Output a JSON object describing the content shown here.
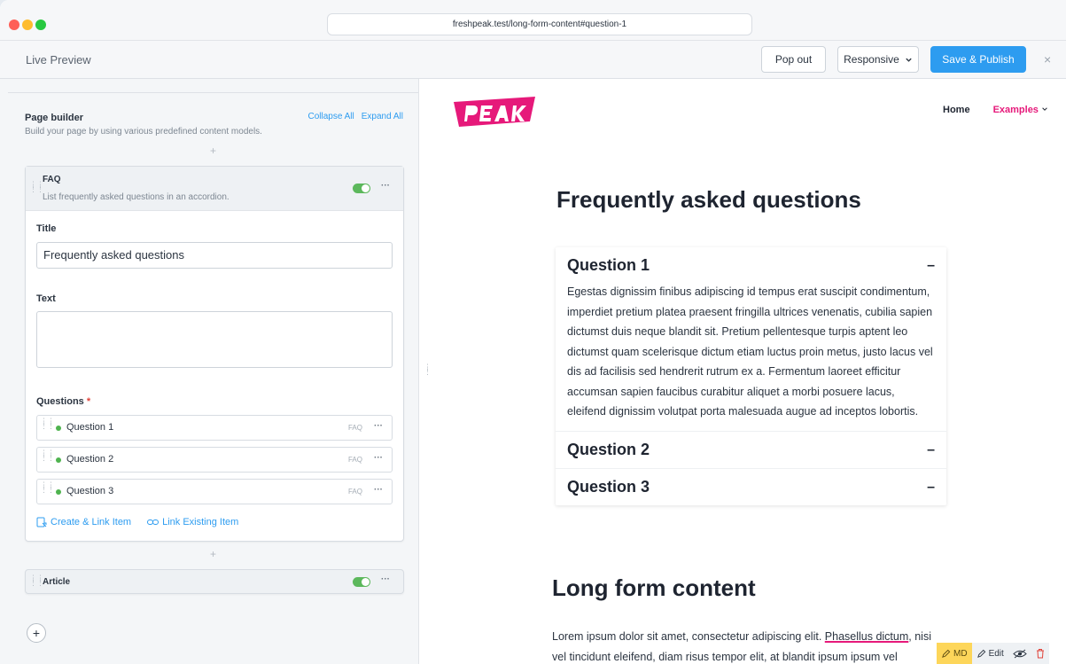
{
  "browser": {
    "url": "freshpeak.test/long-form-content#question-1"
  },
  "toolbar": {
    "title": "Live Preview",
    "popout_label": "Pop out",
    "responsive_label": "Responsive",
    "publish_label": "Save & Publish",
    "close_label": "×"
  },
  "builder": {
    "title": "Page builder",
    "subtitle": "Build your page by using various predefined content models.",
    "collapse_all": "Collapse All",
    "expand_all": "Expand All",
    "plus": "+",
    "faq": {
      "name": "FAQ",
      "description": "List frequently asked questions in an accordion.",
      "enabled": true,
      "more": "···",
      "title_label": "Title",
      "title_value": "Frequently asked questions",
      "text_label": "Text",
      "text_value": "",
      "questions_label": "Questions",
      "required_mark": "*",
      "questions": [
        {
          "label": "Question 1",
          "type": "FAQ",
          "more": "···"
        },
        {
          "label": "Question 2",
          "type": "FAQ",
          "more": "···"
        },
        {
          "label": "Question 3",
          "type": "FAQ",
          "more": "···"
        }
      ],
      "create_link": "Create & Link Item",
      "link_existing": "Link Existing Item"
    },
    "article": {
      "name": "Article",
      "enabled": true,
      "more": "···"
    },
    "add": "+"
  },
  "preview": {
    "nav": {
      "home": "Home",
      "examples": "Examples"
    },
    "faq_heading": "Frequently asked questions",
    "accordion": [
      {
        "title": "Question 1",
        "expanded": true,
        "toggle": "–",
        "body": "Egestas dignissim finibus adipiscing id tempus erat suscipit condimentum, imperdiet pretium platea praesent fringilla ultrices venenatis, cubilia sapien dictumst duis neque blandit sit. Pretium pellentesque turpis aptent leo dictumst quam scelerisque dictum etiam luctus proin metus, justo lacus vel dis ad facilisis sed hendrerit rutrum ex a. Fermentum laoreet efficitur accumsan sapien faucibus curabitur aliquet a morbi posuere lacus, eleifend dignissim volutpat porta malesuada augue ad inceptos lobortis."
      },
      {
        "title": "Question 2",
        "expanded": false,
        "toggle": "–"
      },
      {
        "title": "Question 3",
        "expanded": false,
        "toggle": "–"
      }
    ],
    "long_form_heading": "Long form content",
    "lorem_start": "Lorem ipsum dolor sit amet, consectetur adipiscing elit. ",
    "lorem_link": "Phasellus dictum",
    "lorem_end": ", nisi vel tincidunt eleifend, diam risus tempor elit, at blandit ipsum ipsum vel",
    "md_toolbar": {
      "md": "MD",
      "edit": "Edit"
    }
  },
  "colors": {
    "accent": "#2d9cf0",
    "brand": "#e6197a",
    "toggle_on": "#5cb85c",
    "status_dot": "#4fb34f"
  }
}
